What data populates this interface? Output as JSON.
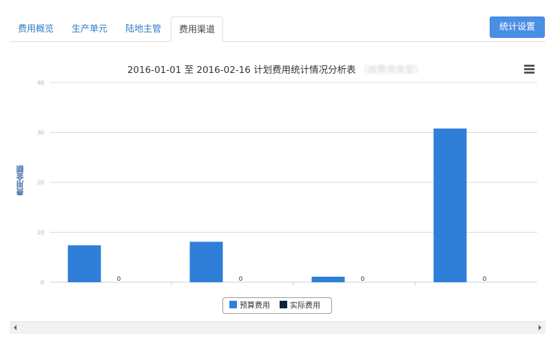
{
  "tabs": [
    {
      "label": "费用概览",
      "active": false
    },
    {
      "label": "生产单元",
      "active": false
    },
    {
      "label": "陆地主管",
      "active": false
    },
    {
      "label": "费用渠道",
      "active": true
    }
  ],
  "toolbar": {
    "stat_settings_label": "统计设置"
  },
  "menu_icon": "hamburger-menu-icon",
  "chart_data": {
    "type": "bar",
    "title": "2016-01-01 至 2016-02-16 计划费用统计情况分析表",
    "title_suffix_blurred": "（按费用类型）",
    "ylabel": "费用金额",
    "categories": [
      "",
      "",
      "",
      ""
    ],
    "ylim": [
      0,
      40
    ],
    "y_ticks": [
      "0",
      "10",
      "20",
      "30",
      "40"
    ],
    "grid": true,
    "legend_position": "bottom-center",
    "series": [
      {
        "name": "预算费用",
        "color": "#2f7ed8",
        "values": [
          7.4,
          8.1,
          1.1,
          30.8
        ],
        "labels": [
          "",
          "",
          "",
          ""
        ]
      },
      {
        "name": "实际费用",
        "color": "#0d233a",
        "values": [
          0,
          0,
          0,
          0
        ],
        "labels": [
          "0",
          "0",
          "0",
          "0"
        ]
      }
    ]
  },
  "colors": {
    "accent": "#4a8fe6",
    "tab_link": "#2f7ec4"
  }
}
